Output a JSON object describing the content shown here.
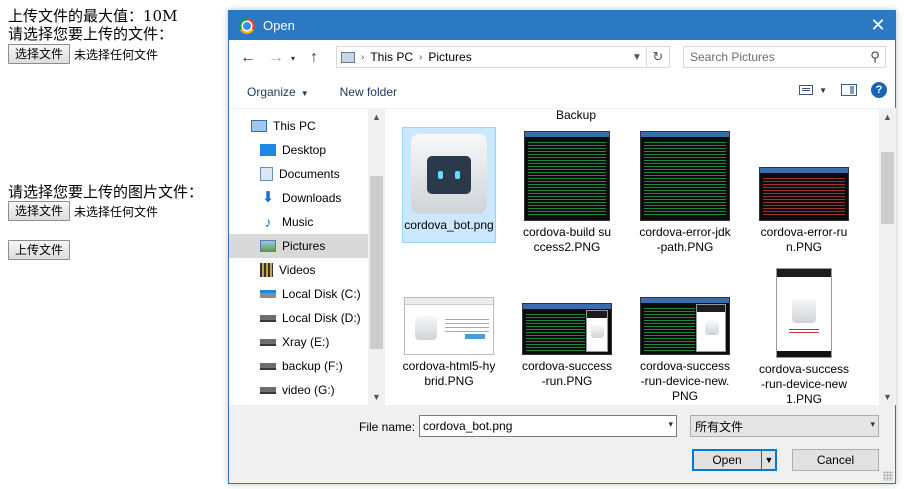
{
  "page": {
    "max_size_line": "上传文件的最大值：10M",
    "choose_file_prompt": "请选择您要上传的文件：",
    "choose_image_prompt": "请选择您要上传的图片文件：",
    "choose_button": "选择文件",
    "no_file_text": "未选择任何文件",
    "upload_button": "上传文件"
  },
  "dialog": {
    "title": "Open",
    "close_glyph": "✕",
    "nav": {
      "back": "←",
      "forward": "→",
      "up": "↑",
      "breadcrumb_sep": "›",
      "breadcrumb": [
        "This PC",
        "Pictures"
      ],
      "refresh": "↻",
      "search_placeholder": "Search Pictures",
      "search_glyph": "⚲"
    },
    "commands": {
      "organize": "Organize",
      "new_folder": "New folder",
      "help": "?"
    },
    "sidebar": [
      {
        "label": "This PC",
        "icon": "computer-icon"
      },
      {
        "label": "Desktop",
        "icon": "desktop-icon"
      },
      {
        "label": "Documents",
        "icon": "documents-icon"
      },
      {
        "label": "Downloads",
        "icon": "downloads-icon"
      },
      {
        "label": "Music",
        "icon": "music-icon"
      },
      {
        "label": "Pictures",
        "icon": "pictures-icon",
        "selected": true
      },
      {
        "label": "Videos",
        "icon": "videos-icon"
      },
      {
        "label": "Local Disk (C:)",
        "icon": "drive-icon"
      },
      {
        "label": "Local Disk (D:)",
        "icon": "drive-icon"
      },
      {
        "label": "Xray (E:)",
        "icon": "drive-icon"
      },
      {
        "label": "backup (F:)",
        "icon": "drive-icon"
      },
      {
        "label": "video (G:)",
        "icon": "drive-icon"
      }
    ],
    "partial_label": "Backup",
    "files": [
      {
        "name": "cordova_bot.png",
        "selected": true
      },
      {
        "name": "cordova-build success2.PNG"
      },
      {
        "name": "cordova-error-jdk-path.PNG"
      },
      {
        "name": "cordova-error-run.PNG"
      },
      {
        "name": "cordova-html5-hybrid.PNG"
      },
      {
        "name": "cordova-success-run.PNG"
      },
      {
        "name": "cordova-success-run-device-new.PNG"
      },
      {
        "name": "cordova-success-run-device-new1.PNG"
      }
    ],
    "file_name_label": "File name:",
    "file_name_value": "cordova_bot.png",
    "file_type": "所有文件",
    "open_button": "Open",
    "cancel_button": "Cancel",
    "arrow_up": "▲",
    "arrow_down": "▼",
    "caret": "▾"
  }
}
